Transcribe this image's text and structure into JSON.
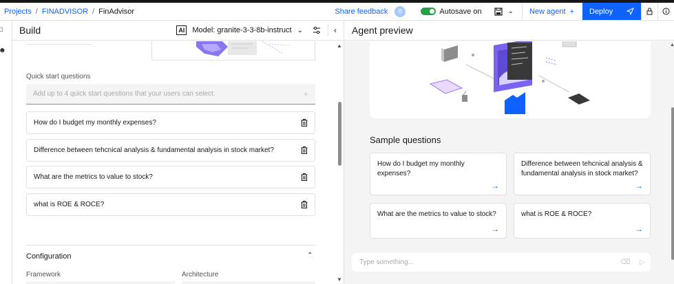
{
  "breadcrumb": {
    "projects": "Projects",
    "sep": "/",
    "project": "FINADVISOR",
    "current": "FinAdvisor"
  },
  "topbar": {
    "share_feedback": "Share feedback",
    "avatar_initial": "B",
    "autosave_label": "Autosave on",
    "new_agent_label": "New agent",
    "deploy_label": "Deploy",
    "colors": {
      "accent": "#0f62fe",
      "toggle_on": "#24a148"
    }
  },
  "build": {
    "title": "Build",
    "ai_badge": "AI",
    "model_label": "Model: granite-3-3-8b-instruct",
    "quick_start": {
      "label": "Quick start questions",
      "placeholder": "Add up to 4 quick start questions that your users can select.",
      "items": [
        {
          "text": "How do I budget my monthly expenses?"
        },
        {
          "text": "Difference between tehcnical analysis & fundamental analysis in stock market?"
        },
        {
          "text": "What are the metrics to value to stock?"
        },
        {
          "text": "what is ROE & ROCE?"
        }
      ]
    },
    "configuration": {
      "title": "Configuration",
      "framework_label": "Framework",
      "architecture_label": "Architecture"
    }
  },
  "preview": {
    "title": "Agent preview",
    "sample_title": "Sample questions",
    "cards": [
      {
        "text": "How do I budget my monthly expenses?"
      },
      {
        "text": "Difference between tehcnical analysis & fundamental analysis in stock market?"
      },
      {
        "text": "What are the metrics to value to stock?"
      },
      {
        "text": "what is ROE & ROCE?"
      }
    ],
    "input_placeholder": "Type something..."
  }
}
